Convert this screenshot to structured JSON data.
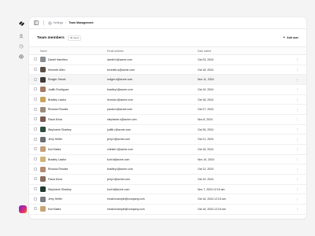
{
  "breadcrumb": {
    "parent": "Settings",
    "current": "Team Management"
  },
  "section": {
    "title": "Team members",
    "count_badge": "36 users",
    "add_label": "Add user"
  },
  "columns": {
    "name": "Name",
    "email": "Email address",
    "date": "Date added"
  },
  "rows": [
    {
      "name": "Daniel Hamilton",
      "email": "daniel.h@acme.com",
      "date": "Oct 23, 2024",
      "avatar": "#8b8f94"
    },
    {
      "name": "Kenneth Allen",
      "email": "kenneth.a@acme.com",
      "date": "Oct 18, 2024",
      "avatar": "#5b5048"
    },
    {
      "name": "Rodger Struck",
      "email": "rodger.s@acme.com",
      "date": "Nov 11, 2024",
      "avatar": "#3f3b39"
    },
    {
      "name": "Judith Rodriguez",
      "email": "bradley.l@acme.com",
      "date": "Oct 19, 2024",
      "avatar": "#a57a62"
    },
    {
      "name": "Bradley Lawlor",
      "email": "rhonda.r@acme.com",
      "date": "Oct 18, 2024",
      "avatar": "#c9a35d"
    },
    {
      "name": "Rhonda Rhodes",
      "email": "paula.m@acme.com",
      "date": "Oct 27, 2024",
      "avatar": "#9c8b7c"
    },
    {
      "name": "Paula Mora",
      "email": "stephanie.s@acme.com",
      "date": "Nov 8, 2024",
      "avatar": "#7a5b4f"
    },
    {
      "name": "Stephanie Sharkey",
      "email": "judith.r@acme.com",
      "date": "Oct 26, 2024",
      "avatar": "#2f4f3e"
    },
    {
      "name": "Jerry Helfer",
      "email": "jerry.h@acme.com",
      "date": "Oct 21, 2024",
      "avatar": "#6b6e73"
    },
    {
      "name": "Kurt Bates",
      "email": "chirstie.r@acme.com",
      "date": "Oct 15, 2024",
      "avatar": "#c2a078"
    },
    {
      "name": "Bradley Lawlor",
      "email": "kurt.b@acme.com",
      "date": "Nov 10, 2024",
      "avatar": "#d1b47a"
    },
    {
      "name": "Rhonda Rhodes",
      "email": "bradley.l@acme.com",
      "date": "Oct 12, 2024",
      "avatar": "#b38a6e"
    },
    {
      "name": "Paula Mora",
      "email": "jerry.h@acme.com",
      "date": "Oct 19, 2024",
      "avatar": "#8a6b5a"
    },
    {
      "name": "Stephanie Sharkey",
      "email": "kurt.b@acme.com",
      "date": "Nov 7, 2024 12:15 am",
      "avatar": "#1f3a2e"
    },
    {
      "name": "Jerry Helfer",
      "email": "email.example@company.com",
      "date": "Oct 16, 2024 12:15 am",
      "avatar": "#7c7f84"
    },
    {
      "name": "Kurt Bates",
      "email": "email.example@company.com",
      "date": "Oct 16, 2024 12:15 am",
      "avatar": "#c7a472"
    }
  ],
  "more_glyph": "⋮"
}
